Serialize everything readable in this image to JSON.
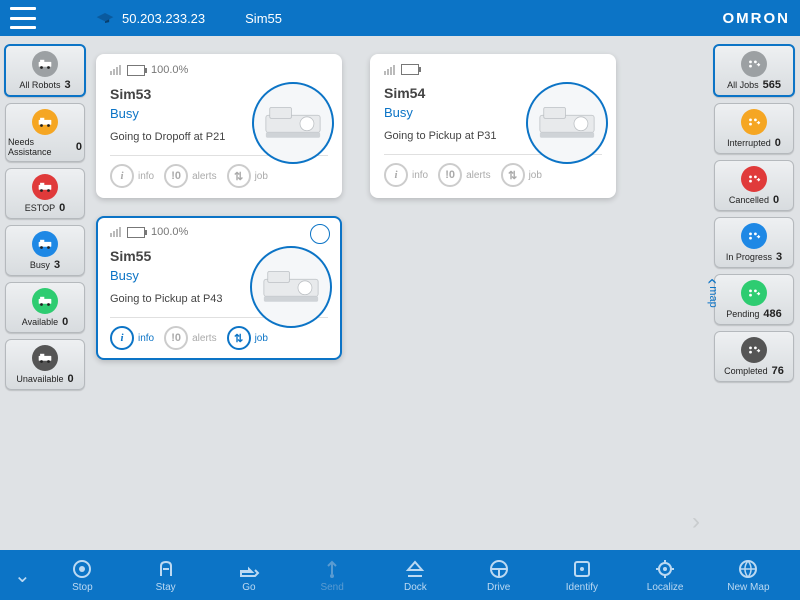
{
  "header": {
    "ip": "50.203.233.23",
    "title": "Sim55",
    "brand": "OMRON"
  },
  "left_sidebar": [
    {
      "id": "all-robots",
      "label": "All Robots",
      "count": 3,
      "color": "gray",
      "selected": true
    },
    {
      "id": "needs-assistance",
      "label": "Needs Assistance",
      "count": 0,
      "color": "orange"
    },
    {
      "id": "estop",
      "label": "ESTOP",
      "count": 0,
      "color": "red"
    },
    {
      "id": "busy",
      "label": "Busy",
      "count": 3,
      "color": "blue"
    },
    {
      "id": "available",
      "label": "Available",
      "count": 0,
      "color": "green"
    },
    {
      "id": "unavailable",
      "label": "Unavailable",
      "count": 0,
      "color": "dark"
    }
  ],
  "right_sidebar": [
    {
      "id": "all-jobs",
      "label": "All Jobs",
      "count": 565,
      "color": "gray",
      "selected": true
    },
    {
      "id": "interrupted",
      "label": "Interrupted",
      "count": 0,
      "color": "orange"
    },
    {
      "id": "cancelled",
      "label": "Cancelled",
      "count": 0,
      "color": "red"
    },
    {
      "id": "in-progress",
      "label": "In Progress",
      "count": 3,
      "color": "blue"
    },
    {
      "id": "pending",
      "label": "Pending",
      "count": 486,
      "color": "green"
    },
    {
      "id": "completed",
      "label": "Completed",
      "count": 76,
      "color": "dark"
    }
  ],
  "cards": [
    {
      "name": "Sim53",
      "battery": "100.0%",
      "status": "Busy",
      "desc": "Going to Dropoff at P21",
      "selected": false,
      "actions": {
        "info": "info",
        "alerts": "alerts",
        "job": "job"
      }
    },
    {
      "name": "Sim54",
      "battery": "",
      "status": "Busy",
      "desc": "Going to Pickup at P31",
      "selected": false,
      "actions": {
        "info": "info",
        "alerts": "alerts",
        "job": "job"
      }
    },
    {
      "name": "Sim55",
      "battery": "100.0%",
      "status": "Busy",
      "desc": "Going to Pickup at P43",
      "selected": true,
      "actions": {
        "info": "info",
        "alerts": "alerts",
        "job": "job"
      }
    }
  ],
  "map_label": "map",
  "bottom": [
    {
      "id": "stop",
      "label": "Stop"
    },
    {
      "id": "stay",
      "label": "Stay"
    },
    {
      "id": "go",
      "label": "Go"
    },
    {
      "id": "send",
      "label": "Send",
      "disabled": true
    },
    {
      "id": "dock",
      "label": "Dock"
    },
    {
      "id": "drive",
      "label": "Drive"
    },
    {
      "id": "identify",
      "label": "Identify"
    },
    {
      "id": "localize",
      "label": "Localize"
    },
    {
      "id": "new-map",
      "label": "New Map"
    }
  ]
}
